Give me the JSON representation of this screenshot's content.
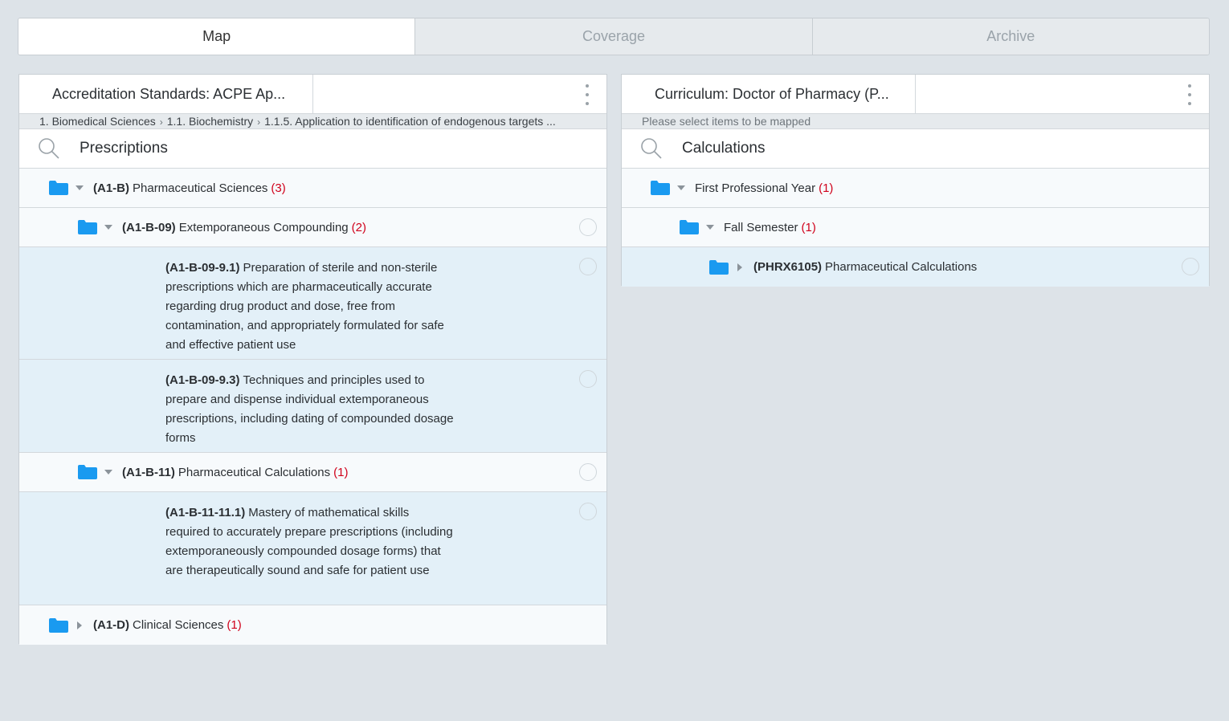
{
  "tabs": [
    {
      "label": "Map",
      "active": true
    },
    {
      "label": "Coverage",
      "active": false
    },
    {
      "label": "Archive",
      "active": false
    }
  ],
  "left_panel": {
    "title": "Accreditation Standards: ACPE Ap...",
    "breadcrumb": [
      "1. Biomedical Sciences",
      "1.1. Biochemistry",
      "1.1.5. Application to identification of endogenous targets ..."
    ],
    "search_value": "Prescriptions",
    "rows": [
      {
        "code": "(A1-B)",
        "label": "Pharmaceutical Sciences",
        "count": "(3)"
      },
      {
        "code": "(A1-B-09)",
        "label": "Extemporaneous Compounding",
        "count": "(2)"
      },
      {
        "code": "(A1-B-09-9.1)",
        "label": "Preparation of sterile and non-sterile prescriptions which are pharmaceutically accurate regarding drug product and dose, free from contamination, and appropriately formulated for safe and effective patient use"
      },
      {
        "code": "(A1-B-09-9.3)",
        "label": "Techniques and principles used to prepare and dispense individual extemporaneous prescriptions, including dating of compounded dosage forms"
      },
      {
        "code": "(A1-B-11)",
        "label": "Pharmaceutical Calculations",
        "count": "(1)"
      },
      {
        "code": "(A1-B-11-11.1)",
        "label": "Mastery of mathematical skills required to accurately prepare prescriptions (including extemporaneously compounded dosage forms) that are therapeutically sound and safe for patient use"
      },
      {
        "code": "(A1-D)",
        "label": "Clinical Sciences",
        "count": "(1)"
      }
    ]
  },
  "right_panel": {
    "title": "Curriculum: Doctor of Pharmacy (P...",
    "hint": "Please select items to be mapped",
    "search_value": "Calculations",
    "rows": [
      {
        "label": "First Professional Year",
        "count": "(1)"
      },
      {
        "label": "Fall Semester",
        "count": "(1)"
      },
      {
        "code": "(PHRX6105)",
        "label": "Pharmaceutical Calculations"
      }
    ]
  },
  "colors": {
    "folder": "#1a9af0",
    "count": "#d0021b",
    "highlight": "#e3f0f8"
  }
}
